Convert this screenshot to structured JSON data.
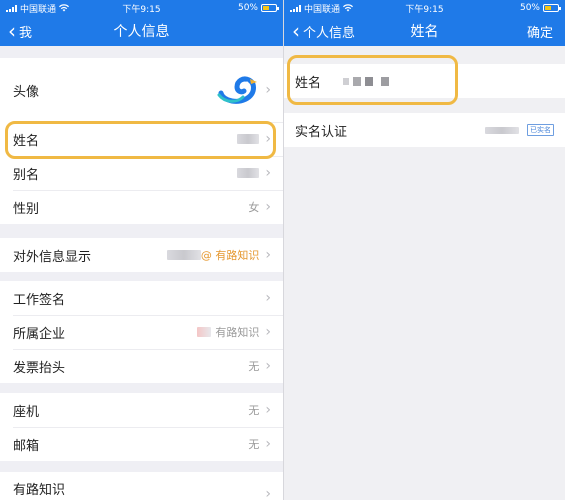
{
  "left": {
    "status_bar": {
      "carrier": "中国联通",
      "time": "下午9:15",
      "battery": "50%"
    },
    "nav": {
      "back_label": "我",
      "title": "个人信息"
    },
    "rows": {
      "avatar": {
        "label": "头像"
      },
      "name": {
        "label": "姓名"
      },
      "alias": {
        "label": "别名"
      },
      "gender": {
        "label": "性别",
        "value": "女"
      },
      "external_info": {
        "label": "对外信息显示",
        "value_suffix": "@ 有路知识"
      },
      "work_signature": {
        "label": "工作签名"
      },
      "company": {
        "label": "所属企业",
        "value": "有路知识"
      },
      "invoice_title": {
        "label": "发票抬头",
        "value": "无"
      },
      "landline": {
        "label": "座机",
        "value": "无"
      },
      "email": {
        "label": "邮箱",
        "value": "无"
      },
      "youlu": {
        "label": "有路知识"
      }
    }
  },
  "right": {
    "status_bar": {
      "carrier": "中国联通",
      "time": "下午9:15",
      "battery": "50%"
    },
    "nav": {
      "back_label": "个人信息",
      "title": "姓名",
      "action_label": "确定"
    },
    "name_field": {
      "label": "姓名"
    },
    "verify": {
      "label": "实名认证",
      "badge": "已实名"
    }
  },
  "colors": {
    "nav_blue": "#1f7ae8",
    "highlight": "#f0b944",
    "accent_orange": "#e5982f"
  },
  "icons": [
    "signal-icon",
    "wifi-icon",
    "battery-icon",
    "back-chevron-icon",
    "chevron-right-icon",
    "bird-avatar-icon"
  ]
}
